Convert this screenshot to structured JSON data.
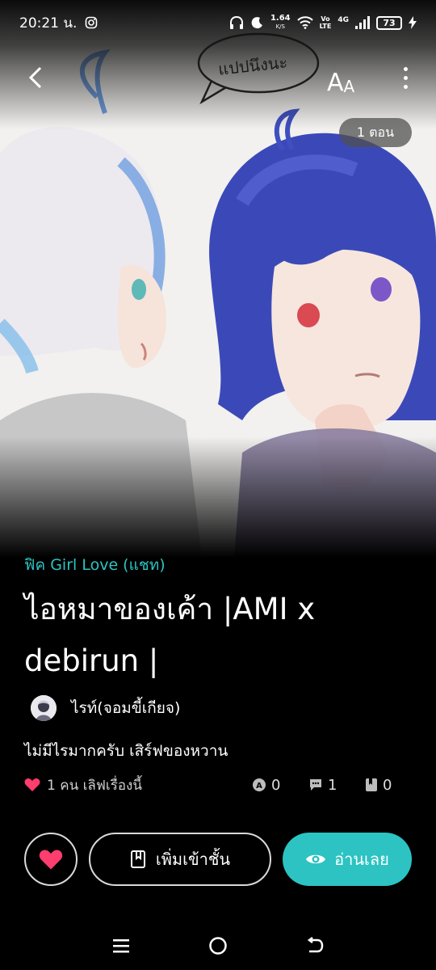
{
  "status_bar": {
    "time": "20:21 น.",
    "net_speed": "1.64",
    "net_unit": "K/S",
    "volte_top": "Vo",
    "volte_bottom": "LTE",
    "network": "4G",
    "battery": "73"
  },
  "header": {
    "font_label_big": "A",
    "font_label_small": "A",
    "episode_count": "1 ตอน",
    "speech_bubble_text": "แปปนึงนะ"
  },
  "story": {
    "category": "ฟิค Girl Love (แชท)",
    "title": "ไอหมาของเค้า |AMI x debirun |",
    "author": "ไรท์(จอมขี้เกียจ)",
    "description": "ไม่มีไรมากครับ เสิร์ฟของหวาน",
    "loves_text": "1 คน เลิฟเรื่องนี้",
    "stat_a": "0",
    "stat_comments": "1",
    "stat_bookmarks": "0"
  },
  "actions": {
    "add_shelf_label": "เพิ่มเข้าชั้น",
    "read_label": "อ่านเลย"
  },
  "colors": {
    "accent": "#2cc3c2",
    "heart": "#ff3d6e",
    "background": "#000000"
  },
  "icons": [
    "back-arrow-icon",
    "font-size-icon",
    "more-vertical-icon",
    "heart-icon",
    "book-icon",
    "eye-icon",
    "menu-icon",
    "home-circle-icon",
    "back-nav-icon"
  ]
}
